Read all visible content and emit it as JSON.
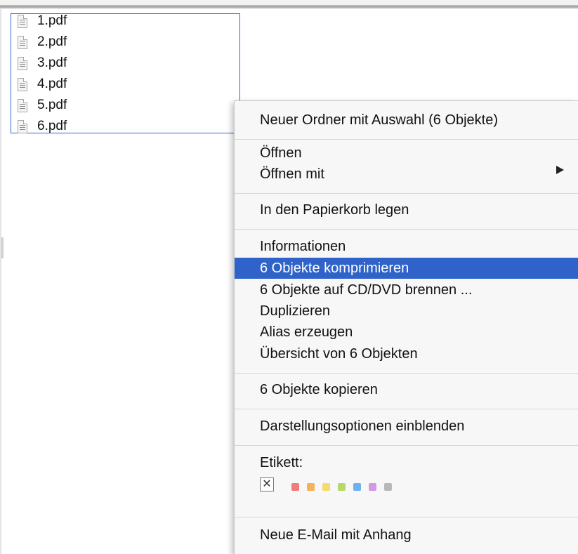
{
  "files": [
    "1.pdf",
    "2.pdf",
    "3.pdf",
    "4.pdf",
    "5.pdf",
    "6.pdf"
  ],
  "context_menu": {
    "new_folder": "Neuer Ordner mit Auswahl (6 Objekte)",
    "open": "Öffnen",
    "open_with": "Öffnen mit",
    "trash": "In den Papierkorb legen",
    "info": "Informationen",
    "compress": "6 Objekte komprimieren",
    "burn": "6 Objekte auf CD/DVD brennen ...",
    "duplicate": "Duplizieren",
    "alias": "Alias erzeugen",
    "quicklook": "Übersicht von 6 Objekten",
    "copy": "6 Objekte kopieren",
    "view_options": "Darstellungsoptionen einblenden",
    "label_heading": "Etikett:",
    "label_none_symbol": "✕",
    "new_mail": "Neue E-Mail mit Anhang",
    "highlighted_item": "6 Objekte komprimieren"
  },
  "label_colors": [
    "#f07d7d",
    "#f5b25a",
    "#f3dc6a",
    "#b4da6a",
    "#6fb0f0",
    "#d09be3",
    "#b8b8b8"
  ],
  "selection_color": "#2f63c9"
}
